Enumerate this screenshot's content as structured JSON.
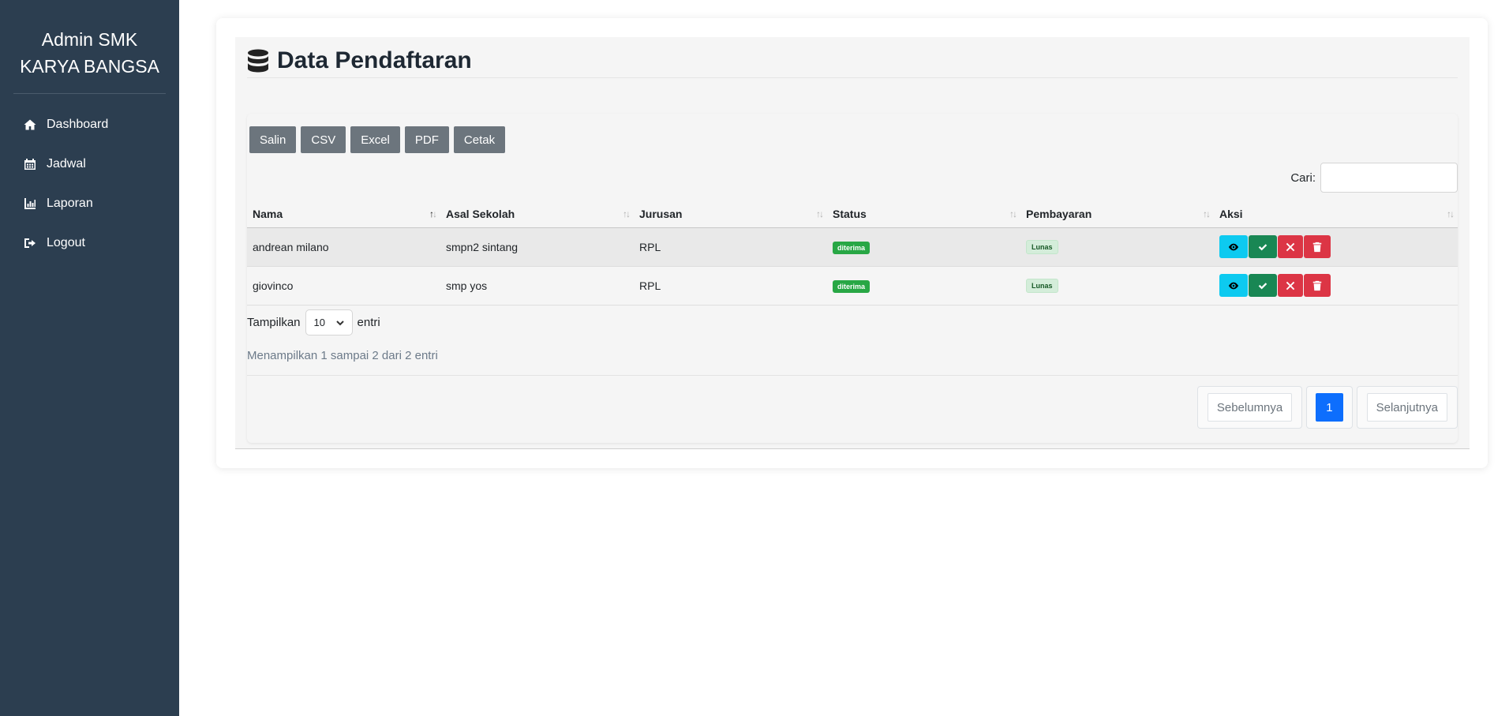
{
  "sidebar": {
    "brand": "Admin SMK KARYA BANGSA",
    "items": [
      {
        "label": "Dashboard",
        "icon": "home-icon"
      },
      {
        "label": "Jadwal",
        "icon": "calendar-icon"
      },
      {
        "label": "Laporan",
        "icon": "chart-bar-icon"
      },
      {
        "label": "Logout",
        "icon": "sign-out-icon"
      }
    ]
  },
  "page": {
    "title": "Data Pendaftaran",
    "title_icon": "database-icon"
  },
  "export_buttons": [
    "Salin",
    "CSV",
    "Excel",
    "PDF",
    "Cetak"
  ],
  "search": {
    "label": "Cari:",
    "value": ""
  },
  "table": {
    "columns": [
      "Nama",
      "Asal Sekolah",
      "Jurusan",
      "Status",
      "Pembayaran",
      "Aksi"
    ],
    "rows": [
      {
        "nama": "andrean milano",
        "asal_sekolah": "smpn2 sintang",
        "jurusan": "RPL",
        "status": "diterima",
        "pembayaran": "Lunas"
      },
      {
        "nama": "giovinco",
        "asal_sekolah": "smp yos",
        "jurusan": "RPL",
        "status": "diterima",
        "pembayaran": "Lunas"
      }
    ]
  },
  "length": {
    "label_before": "Tampilkan",
    "value": "10",
    "label_after": "entri"
  },
  "info": "Menampilkan 1 sampai 2 dari 2 entri",
  "pagination": {
    "prev": "Sebelumnya",
    "current": "1",
    "next": "Selanjutnya"
  },
  "colors": {
    "sidebar": "#2c3e50",
    "info": "#0dcaf0",
    "success": "#198754",
    "danger": "#dc3545",
    "primary": "#0d6efd",
    "secondary": "#6c757d"
  }
}
